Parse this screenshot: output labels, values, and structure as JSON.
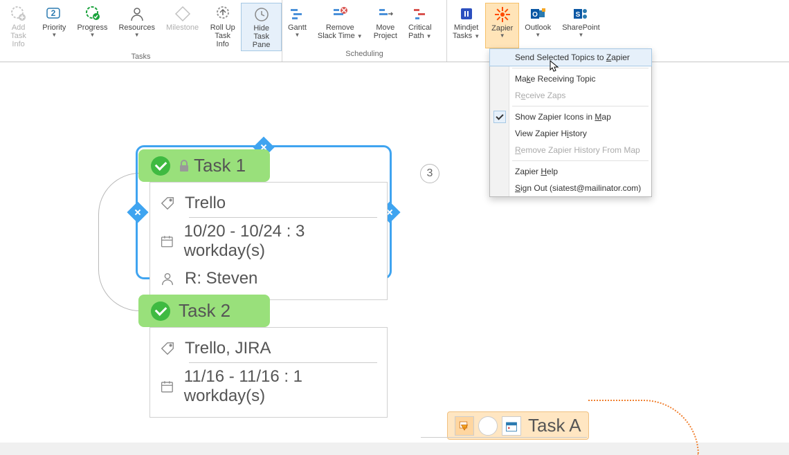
{
  "ribbon": {
    "groups": {
      "tasks": {
        "label": "Tasks",
        "buttons": {
          "addTaskInfo": "Add\nTask Info",
          "priority": "Priority",
          "progress": "Progress",
          "resources": "Resources",
          "milestone": "Milestone",
          "rollUp": "Roll Up\nTask Info",
          "hideTaskPane": "Hide Task\nPane"
        }
      },
      "scheduling": {
        "label": "Scheduling",
        "buttons": {
          "gantt": "Gantt",
          "removeSlack": "Remove\nSlack Time",
          "moveProject": "Move\nProject",
          "criticalPath": "Critical\nPath"
        }
      },
      "integrations": {
        "buttons": {
          "mindjet": "Mindjet\nTasks",
          "zapier": "Zapier",
          "outlook": "Outlook",
          "sharepoint": "SharePoint"
        }
      }
    }
  },
  "menu": {
    "sendSelected": "Send Selected Topics to Zapier",
    "makeReceiving": "Make Receiving Topic",
    "receiveZaps": "Receive Zaps",
    "showIcons": "Show Zapier Icons in Map",
    "viewHistory": "View Zapier History",
    "removeHistory": "Remove Zapier History From Map",
    "help": "Zapier Help",
    "signOut": "Sign Out (siatest@mailinator.com)"
  },
  "tasks": {
    "task1": {
      "title": "Task 1",
      "tag": "Trello",
      "dates": "10/20 - 10/24 : 3 workday(s)",
      "resource": "R: Steven",
      "noteCount": "3"
    },
    "task2": {
      "title": "Task 2",
      "tag": "Trello, JIRA",
      "dates": "11/16 - 11/16 : 1 workday(s)"
    },
    "taskA": {
      "title": "Task A"
    }
  }
}
